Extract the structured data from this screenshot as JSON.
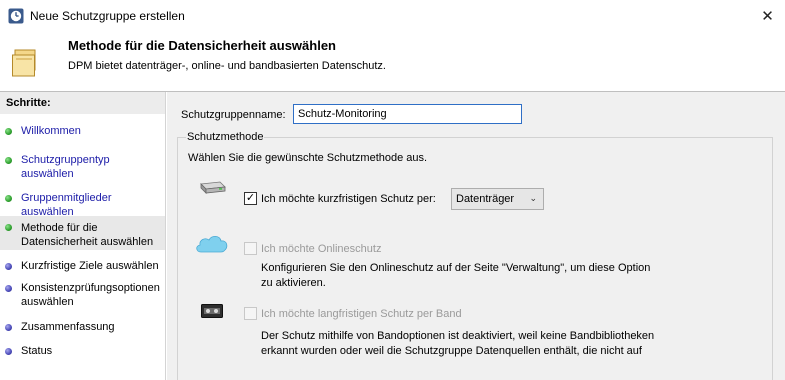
{
  "window": {
    "title": "Neue Schutzgruppe erstellen",
    "close_glyph": "✕",
    "icon": "clock-app-icon"
  },
  "header": {
    "title": "Methode für die Datensicherheit auswählen",
    "subtitle": "DPM bietet datenträger-, online- und bandbasierten Datenschutz.",
    "icon": "folder-icon"
  },
  "sidebar": {
    "heading": "Schritte:",
    "steps": [
      {
        "label": "Willkommen",
        "status": "done"
      },
      {
        "label": "Schutzgruppentyp auswählen",
        "status": "done"
      },
      {
        "label": "Gruppenmitglieder auswählen",
        "status": "done"
      },
      {
        "label": "Methode für die Datensicherheit auswählen",
        "status": "current"
      },
      {
        "label": "Kurzfristige Ziele auswählen",
        "status": "pending"
      },
      {
        "label": "Konsistenzprüfungsoptionen auswählen",
        "status": "pending"
      },
      {
        "label": "Zusammenfassung",
        "status": "pending"
      },
      {
        "label": "Status",
        "status": "pending"
      }
    ]
  },
  "main": {
    "name_label": "Schutzgruppenname:",
    "name_value": "Schutz-Monitoring",
    "method_group": {
      "legend": "Schutzmethode",
      "description": "Wählen Sie die gewünschte Schutzmethode aus.",
      "short_term": {
        "label": "Ich möchte kurzfristigen Schutz per:",
        "checked": true,
        "selected_option": "Datenträger",
        "icon": "disk-drive-icon"
      },
      "online": {
        "label": "Ich möchte Onlineschutz",
        "checked": false,
        "enabled": false,
        "description": "Konfigurieren Sie den Onlineschutz auf der Seite \"Verwaltung\", um diese Option zu aktivieren.",
        "icon": "cloud-icon"
      },
      "tape": {
        "label": "Ich möchte langfristigen Schutz per Band",
        "checked": false,
        "enabled": false,
        "description": "Der Schutz mithilfe von Bandoptionen ist deaktiviert, weil keine Bandbibliotheken erkannt wurden oder weil die Schutzgruppe Datenquellen enthält, die nicht auf",
        "icon": "tape-icon"
      }
    }
  },
  "colors": {
    "done_dot": "#2fa12f",
    "pending_dot": "#4a4ab9",
    "link_text": "#1c1ca8",
    "input_focus_border": "#2f6fc6"
  }
}
